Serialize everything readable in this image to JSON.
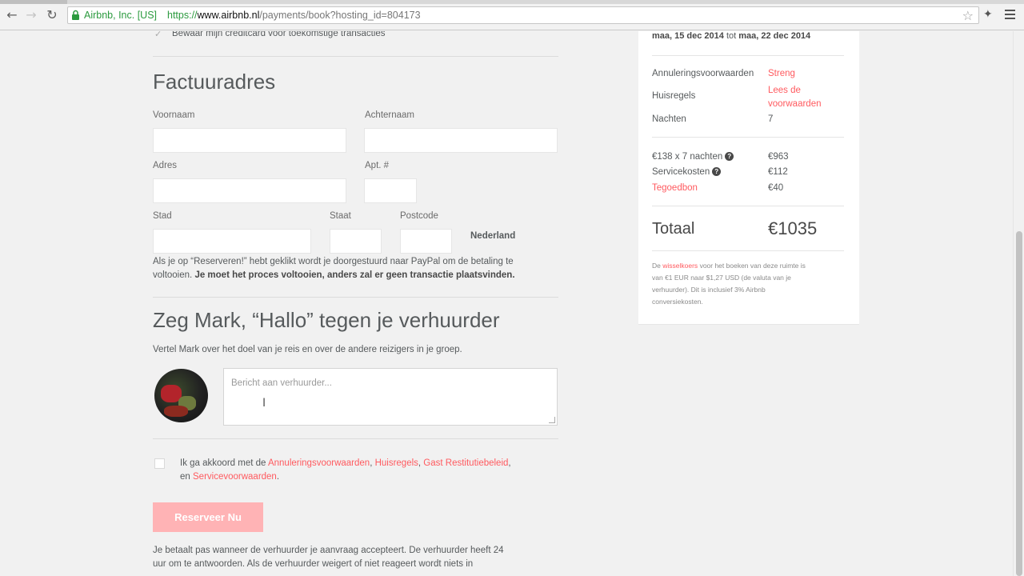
{
  "browser": {
    "ev_badge": "Airbnb, Inc. [US]",
    "url_protocol": "https://",
    "url_host": "www.airbnb.nl",
    "url_path": "/payments/book?hosting_id=804173"
  },
  "form": {
    "save_card_label": "Bewaar mijn creditcard voor toekomstige transacties",
    "billing_heading": "Factuuradres",
    "first_name_label": "Voornaam",
    "last_name_label": "Achternaam",
    "address_label": "Adres",
    "apt_label": "Apt. #",
    "city_label": "Stad",
    "state_label": "Staat",
    "postcode_label": "Postcode",
    "country": "Nederland",
    "paypal_note_1": "Als je op “Reserveren!” hebt geklikt wordt je doorgestuurd naar PayPal om de betaling te",
    "paypal_note_2_plain": "voltooien.",
    "paypal_note_2_bold": "Je moet het proces voltooien, anders zal er geen transactie plaatsvinden.",
    "hello_heading": "Zeg Mark, “Hallo” tegen je verhuurder",
    "hello_sub": "Vertel Mark over het doel van je reis en over de andere reizigers in je groep.",
    "message_placeholder": "Bericht aan verhuurder...",
    "agree_prefix": "Ik ga akkoord met de",
    "agree_link_1": "Annuleringsvoorwaarden",
    "agree_link_2": "Huisregels",
    "agree_link_3": "Gast Restitutiebeleid",
    "agree_and": "en",
    "agree_link_4": "Servicevoorwaarden",
    "reserve_button": "Reserveer Nu",
    "pay_note_1": "Je betaalt pas wanneer de verhuurder je aanvraag accepteert. De verhuurder heeft 24",
    "pay_note_2": "uur om te antwoorden. Als de verhuurder weigert of niet reageert wordt niets in"
  },
  "summary": {
    "date_from": "maa, 15 dec 2014",
    "date_to_word": "tot",
    "date_to": "maa, 22 dec 2014",
    "cancel_label": "Annuleringsvoorwaarden",
    "cancel_value": "Streng",
    "rules_label": "Huisregels",
    "rules_value_1": "Lees de",
    "rules_value_2": "voorwaarden",
    "nights_label": "Nachten",
    "nights_value": "7",
    "price_label": "€138 x 7 nachten",
    "price_value": "€963",
    "service_label": "Servicekosten",
    "service_value": "€112",
    "credit_label": "Tegoedbon",
    "credit_value": "€40",
    "total_label": "Totaal",
    "total_value": "€1035",
    "note_prefix": "De",
    "note_link": "wisselkoers",
    "note_rest_1": "voor het boeken van deze ruimte is",
    "note_line_2": "van €1 EUR naar $1,27 USD (de valuta van je",
    "note_line_3": "verhuurder). Dit is inclusief 3% Airbnb",
    "note_line_4": "conversiekosten."
  },
  "colors": {
    "brand": "#ff5a5f",
    "button_disabled": "#ffb3b5",
    "secure_green": "#2b9a3e"
  }
}
